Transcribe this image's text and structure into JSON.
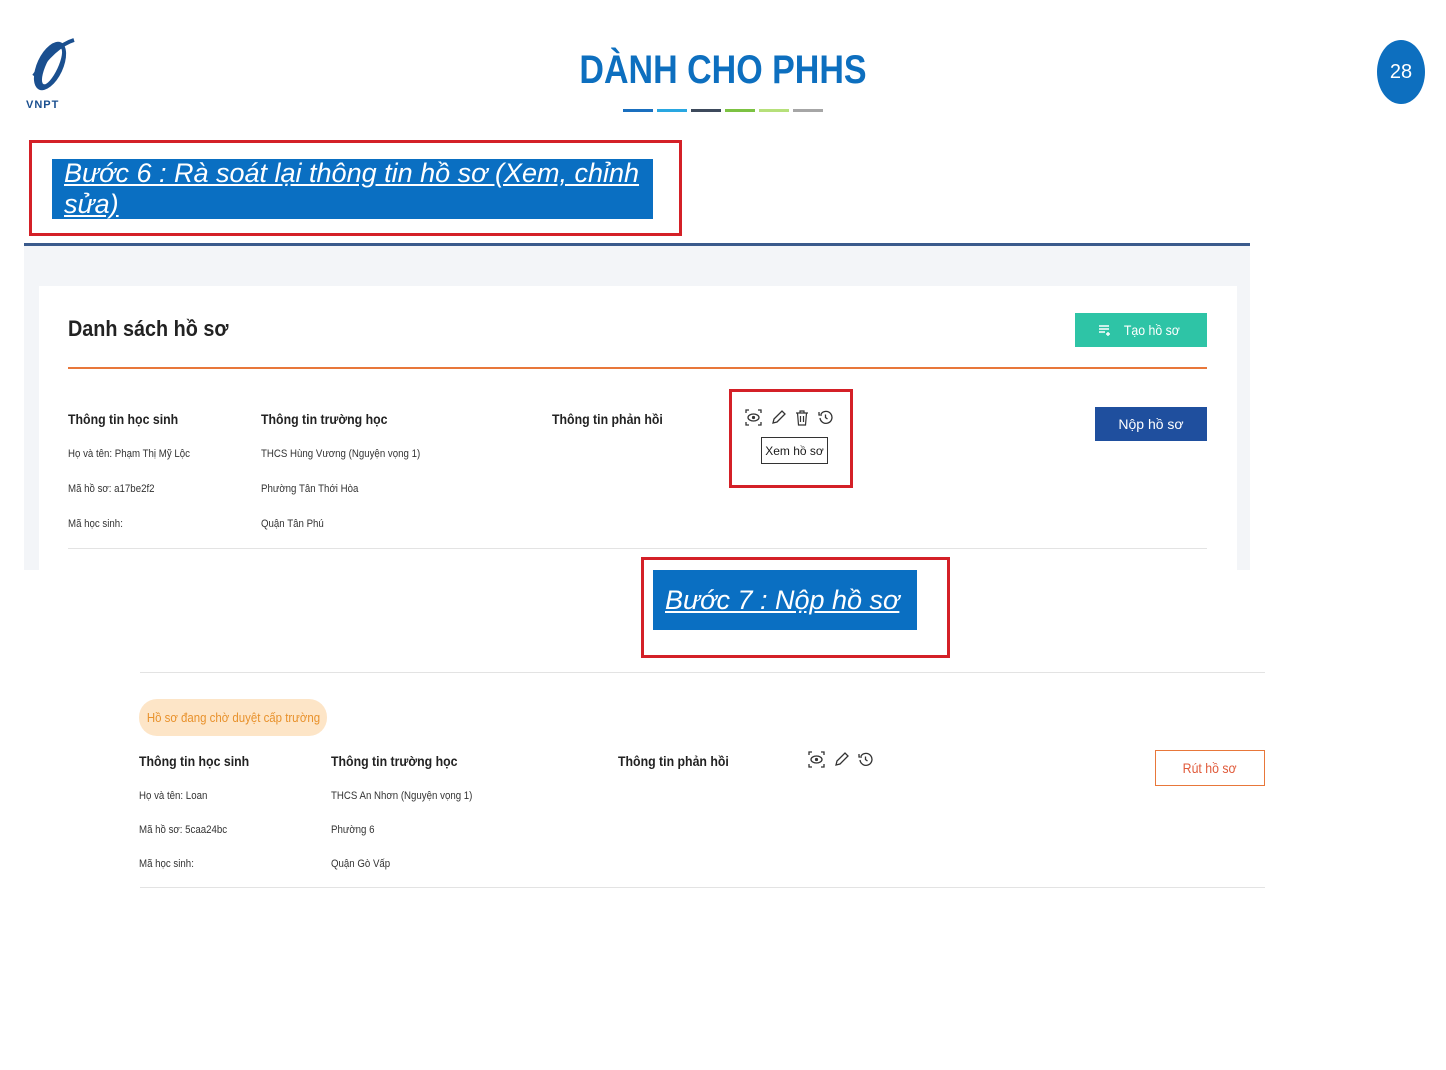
{
  "header": {
    "logo_text": "VNPT",
    "title": "DÀNH CHO PHHS",
    "page_number": "28",
    "underline_colors": [
      "#1a6fbf",
      "#29a7e1",
      "#3d4a5c",
      "#7cc242",
      "#b6e07a",
      "#a6a6a6"
    ]
  },
  "steps": {
    "step6": "Bước 6 : Rà soát lại thông tin hồ sơ (Xem, chỉnh sửa)",
    "step7": "Bước 7 : Nộp hồ sơ"
  },
  "screen1": {
    "list_title": "Danh sách hồ sơ",
    "create_button": "Tạo hồ sơ",
    "columns": {
      "student": "Thông tin học sinh",
      "school": "Thông tin trường học",
      "feedback": "Thông tin phản hồi"
    },
    "student": {
      "name": "Họ và tên: Phạm Thị Mỹ Lộc",
      "record_code": "Mã hồ sơ: a17be2f2",
      "student_code": "Mã học sinh:"
    },
    "school": {
      "name": "THCS Hùng Vương (Nguyện vọng 1)",
      "ward": "Phường Tân Thới Hòa",
      "district": "Quận Tân Phú"
    },
    "tooltip": "Xem hồ sơ",
    "submit_button": "Nộp hồ sơ"
  },
  "screen2": {
    "status_badge": "Hồ sơ đang chờ duyệt cấp trường",
    "columns": {
      "student": "Thông tin học sinh",
      "school": "Thông tin trường học",
      "feedback": "Thông tin phản hồi"
    },
    "student": {
      "name": "Họ và tên: Loan",
      "record_code": "Mã hồ sơ: 5caa24bc",
      "student_code": "Mã học sinh:"
    },
    "school": {
      "name": "THCS An Nhơn (Nguyện vọng 1)",
      "ward": "Phường 6",
      "district": "Quận Gò Vấp"
    },
    "withdraw_button": "Rút hồ sơ"
  },
  "colors": {
    "brand_blue": "#0d6fbf",
    "highlight_red": "#d42027",
    "create_green": "#2ec4a6",
    "submit_navy": "#1f4f9e",
    "accent_orange": "#e8773a"
  }
}
